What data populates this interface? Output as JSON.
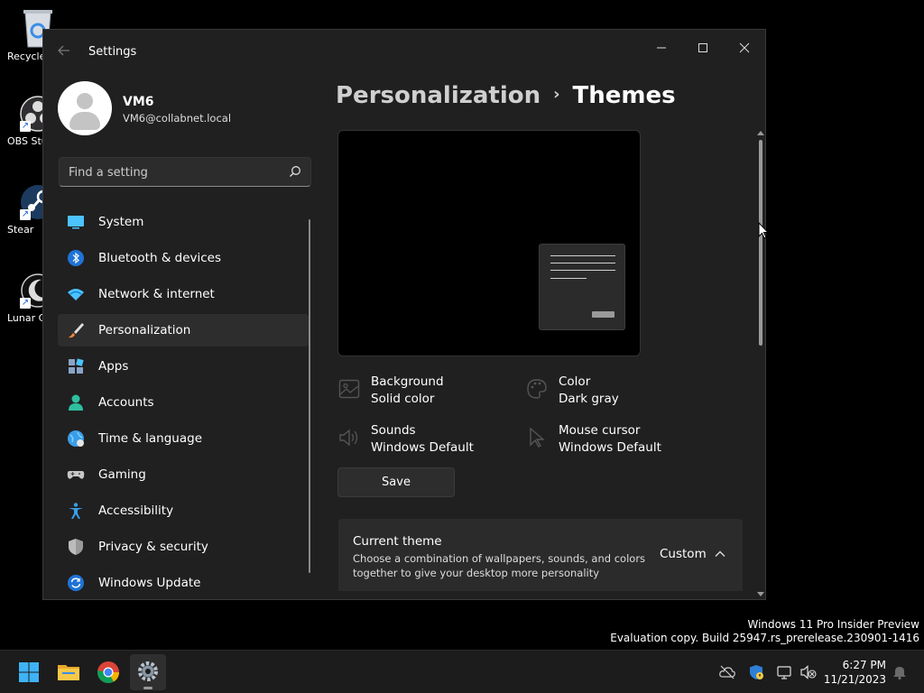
{
  "desktop": {
    "icons": [
      {
        "label": "Recycle",
        "name": "recycle-bin"
      },
      {
        "label": "OBS Stu",
        "name": "obs-studio"
      },
      {
        "label": "Stear",
        "name": "steam"
      },
      {
        "label": "Lunar C",
        "name": "lunar-client"
      }
    ]
  },
  "window": {
    "title": "Settings",
    "controls": {
      "minimize": "—",
      "maximize": "▢",
      "close": "✕"
    }
  },
  "user": {
    "name": "VM6",
    "email": "VM6@collabnet.local"
  },
  "search": {
    "placeholder": "Find a setting"
  },
  "nav": {
    "items": [
      {
        "label": "System"
      },
      {
        "label": "Bluetooth & devices"
      },
      {
        "label": "Network & internet"
      },
      {
        "label": "Personalization"
      },
      {
        "label": "Apps"
      },
      {
        "label": "Accounts"
      },
      {
        "label": "Time & language"
      },
      {
        "label": "Gaming"
      },
      {
        "label": "Accessibility"
      },
      {
        "label": "Privacy & security"
      },
      {
        "label": "Windows Update"
      }
    ]
  },
  "breadcrumb": {
    "parent": "Personalization",
    "separator": "›",
    "current": "Themes"
  },
  "properties": {
    "background": {
      "title": "Background",
      "value": "Solid color"
    },
    "color": {
      "title": "Color",
      "value": "Dark gray"
    },
    "sounds": {
      "title": "Sounds",
      "value": "Windows Default"
    },
    "cursor": {
      "title": "Mouse cursor",
      "value": "Windows Default"
    }
  },
  "save_label": "Save",
  "current_theme": {
    "title": "Current theme",
    "description": "Choose a combination of wallpapers, sounds, and colors together to give your desktop more personality",
    "value": "Custom"
  },
  "watermark": {
    "line1": "Windows 11 Pro Insider Preview",
    "line2": "Evaluation copy. Build 25947.rs_prerelease.230901-1416"
  },
  "clock": {
    "time": "6:27 PM",
    "date": "11/21/2023"
  },
  "colors": {
    "accent": "#4cc2ff",
    "window_bg": "#202020",
    "taskbar_bg": "#1c1c1c"
  }
}
